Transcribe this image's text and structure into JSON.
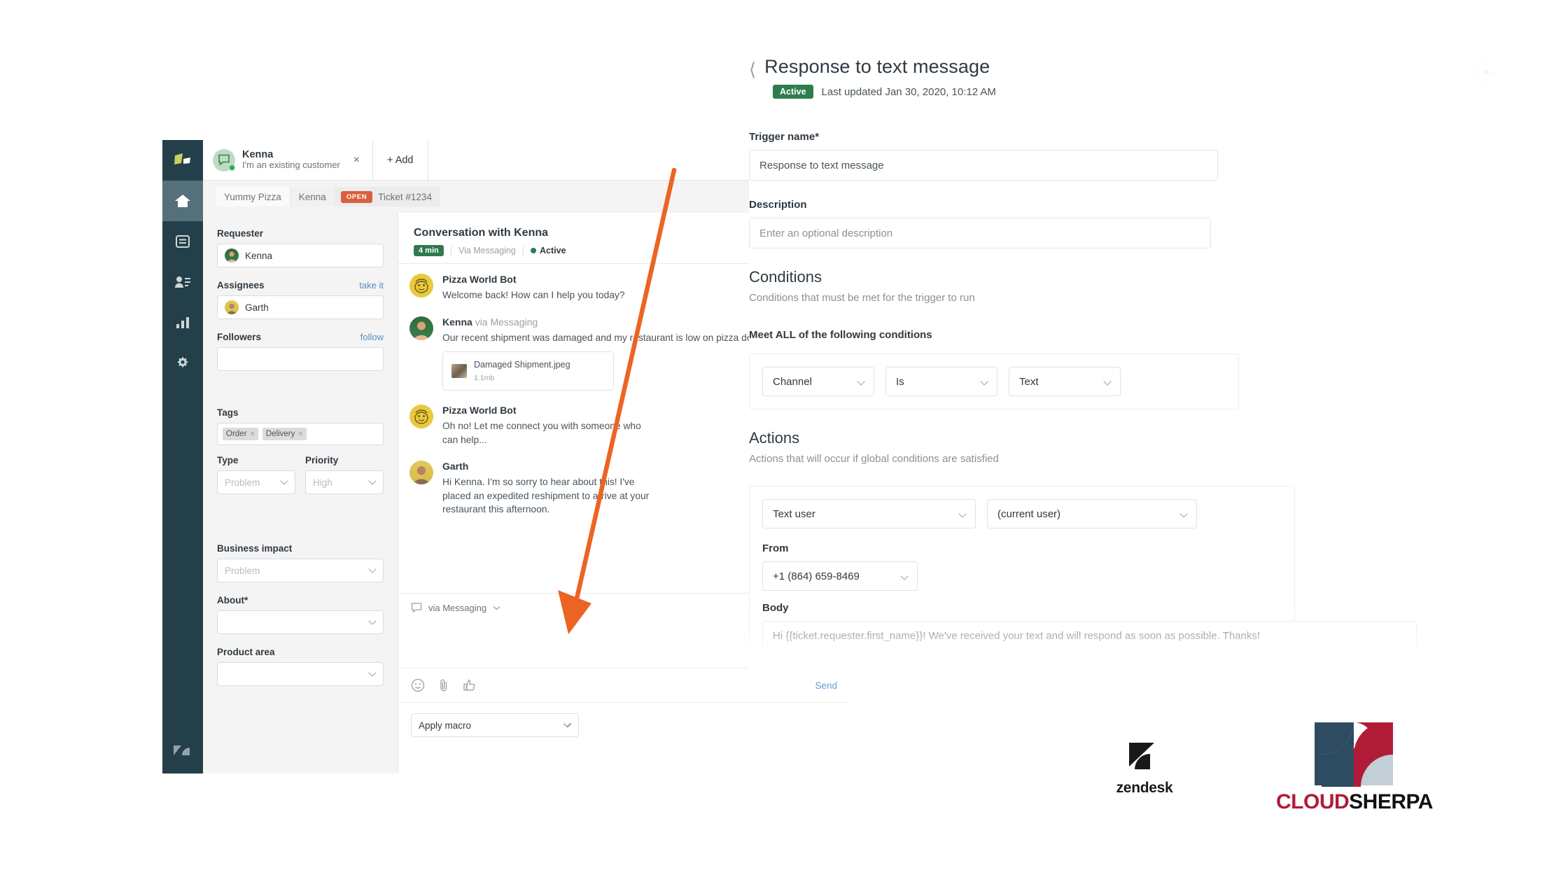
{
  "zendesk_ticket": {
    "nav": {
      "items": [
        {
          "name": "products-logo",
          "label": "Zendesk products"
        },
        {
          "name": "home",
          "label": "Home"
        },
        {
          "name": "views",
          "label": "Views"
        },
        {
          "name": "customers",
          "label": "Customers"
        },
        {
          "name": "reporting",
          "label": "Reporting"
        },
        {
          "name": "admin",
          "label": "Admin"
        }
      ],
      "footer_logo": "zendesk-z-logo"
    },
    "tab": {
      "name": "Kenna",
      "subtitle": "I'm an existing customer",
      "close_label": "×",
      "add_label": "+ Add"
    },
    "breadcrumb": {
      "org": "Yummy Pizza",
      "requester": "Kenna",
      "status_badge": "OPEN",
      "ticket": "Ticket #1234"
    },
    "properties": {
      "requester_label": "Requester",
      "requester_value": "Kenna",
      "assignees_label": "Assignees",
      "assignees_action": "take it",
      "assignees_value": "Garth",
      "followers_label": "Followers",
      "followers_action": "follow",
      "followers_value": "",
      "tags_label": "Tags",
      "tags": [
        "Order",
        "Delivery"
      ],
      "type_label": "Type",
      "type_value": "Problem",
      "priority_label": "Priority",
      "priority_value": "High",
      "business_impact_label": "Business impact",
      "business_impact_value": "Problem",
      "about_label": "About*",
      "about_value": "",
      "product_area_label": "Product area",
      "product_area_value": ""
    },
    "conversation": {
      "title": "Conversation with Kenna",
      "duration_badge": "4 min",
      "via": "Via Messaging",
      "status": "Active",
      "messages": [
        {
          "author": "Pizza World Bot",
          "via": "",
          "text": "Welcome back! How can I help you today?",
          "avatar": "bot-avatar"
        },
        {
          "author": "Kenna",
          "via": "via Messaging",
          "text": "Our recent shipment was damaged and my restaurant is low on pizza dough, help!",
          "avatar": "kenna-avatar",
          "attachment": {
            "name": "Damaged Shipment.jpeg",
            "size": "1.1mb"
          }
        },
        {
          "author": "Pizza World Bot",
          "via": "",
          "text": "Oh no! Let me connect you with someone who can help...",
          "avatar": "bot-avatar"
        },
        {
          "author": "Garth",
          "via": "",
          "text": "Hi Kenna. I'm so sorry to hear about this! I've placed an expedited reshipment to arrive at your restaurant this afternoon.",
          "avatar": "garth-avatar"
        }
      ],
      "channel_selector": "via Messaging",
      "composer": {
        "emoji_icon": "emoji-icon",
        "attach_icon": "paperclip-icon",
        "thumbsup_icon": "thumbs-up-icon",
        "send_label": "Send",
        "macro_label": "Apply macro"
      }
    }
  },
  "trigger_editor": {
    "back_icon": "chevron-left-icon",
    "title": "Response to text message",
    "status_badge": "Active",
    "last_updated": "Last updated Jan 30, 2020, 10:12 AM",
    "more_icon": "ellipsis-icon",
    "trigger_name_label": "Trigger name*",
    "trigger_name_value": "Response to text message",
    "description_label": "Description",
    "description_placeholder": "Enter an optional description",
    "conditions": {
      "heading": "Conditions",
      "subtitle": "Conditions that must be met for the trigger to run",
      "meet_label": "Meet ALL of the following conditions",
      "row": {
        "field": "Channel",
        "operator": "Is",
        "value": "Text"
      }
    },
    "actions": {
      "heading": "Actions",
      "subtitle": "Actions that will occur if global conditions are satisfied",
      "action_type": "Text user",
      "action_target": "(current user)",
      "from_label": "From",
      "from_value": "+1 (864) 659-8469",
      "body_label": "Body",
      "body_value": "Hi {{ticket.requester.first_name}}! We've received your text and will respond as soon as possible. Thanks!"
    }
  },
  "annotation": {
    "arrow_color": "#ec6424"
  },
  "logos": {
    "zendesk": {
      "wordmark": "zendesk"
    },
    "cloudsherpa": {
      "word_red": "CLOUD",
      "word_black": "SHERPA"
    }
  },
  "colors": {
    "nav_bg": "#23404a",
    "status_open": "#d9603e",
    "status_active": "#2e7d4f",
    "link": "#5a8bbd",
    "arrow": "#ec6424",
    "cloudsherpa_red": "#b01c38",
    "cloudsherpa_navy": "#2d4c61",
    "cloudsherpa_grey": "#c3ced6"
  }
}
